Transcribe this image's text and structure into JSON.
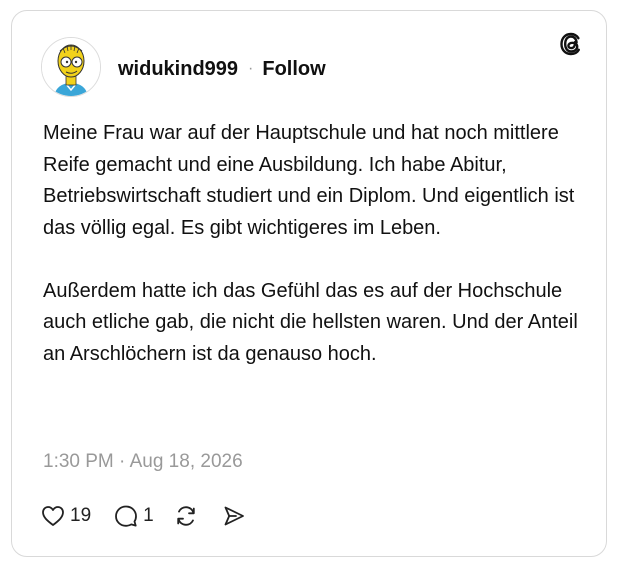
{
  "post": {
    "username": "widukind999",
    "separator": "·",
    "follow_label": "Follow",
    "paragraphs": [
      "Meine Frau war auf der Hauptschule und hat noch mittlere Reife gemacht und eine Ausbildung. Ich habe Abitur,  Betriebswirtschaft studiert und ein Diplom. Und eigentlich ist das völlig egal. Es gibt wichtigeres im Leben.",
      "Außerdem hatte ich das Gefühl  das es auf der Hochschule auch etliche gab, die nicht die hellsten waren.  Und der Anteil an Arschlöchern ist da genauso hoch."
    ],
    "timestamp": "1:30 PM · Aug 18, 2026",
    "likes": "19",
    "replies": "1"
  },
  "icons": {
    "logo": "threads-icon",
    "avatar": "cartoon-avatar",
    "like": "heart-icon",
    "reply": "comment-icon",
    "repost": "repost-icon",
    "share": "send-icon"
  },
  "colors": {
    "text": "#111111",
    "muted": "#999999",
    "border": "#d9d9d9",
    "avatar_skin": "#f2d21b",
    "avatar_shirt": "#3aa6d8"
  }
}
